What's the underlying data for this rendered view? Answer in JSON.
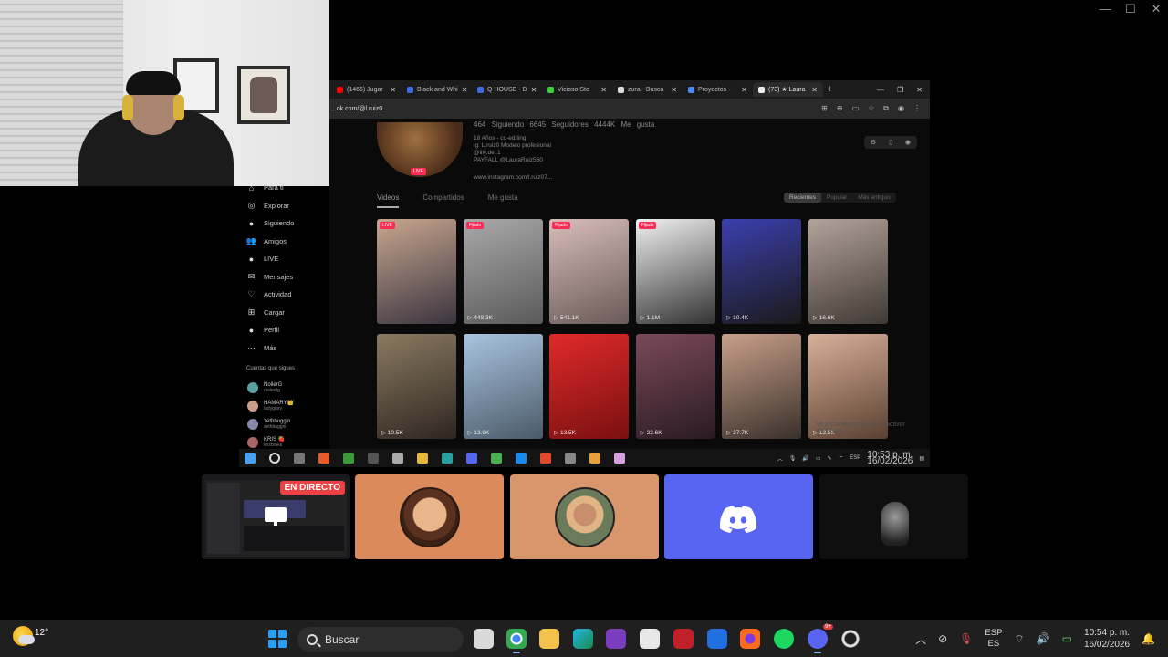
{
  "webcam": {},
  "browser": {
    "tabs": [
      {
        "label": "(1466) Jugar",
        "color": "#ff0000"
      },
      {
        "label": "Black and Whi",
        "color": "#3b6ce0"
      },
      {
        "label": "Q HOUSE - D",
        "color": "#3b6ce0"
      },
      {
        "label": "Vicioso Sto",
        "color": "#3ad13a"
      },
      {
        "label": "zura - Busca",
        "color": "#dddddd"
      },
      {
        "label": "Proyectos -",
        "color": "#4a8cf0"
      },
      {
        "label": "(73) ★ Laura",
        "color": "#eeeeee"
      }
    ],
    "url": "...ok.com/@l.ruiz0",
    "profile": {
      "stats": "464  Siguiendo  6645  Seguidores  4444K  Me gusta",
      "bio_lines": [
        "18 Años - co-ed/ling",
        "lg: L.ruiz0 Modelo profesional",
        "@lily.del.1",
        "PAYFALL @LauraRuiz560",
        "www.instagram.com/l.ruiz07..."
      ],
      "live_badge": "LIVE"
    },
    "tabs_profile": [
      "Videos",
      "Compartidos",
      "Me gusta"
    ],
    "sort": [
      "Recientes",
      "Popular",
      "Más antiguo"
    ],
    "videos": [
      {
        "views": "",
        "badge": "LIVE",
        "c1": "#c8a68e",
        "c2": "#3b3540"
      },
      {
        "views": "▷ 448.3K",
        "badge": "Fijado",
        "c1": "#a9a9a9",
        "c2": "#5a5a5a"
      },
      {
        "views": "▷ 541.1K",
        "badge": "Fijado",
        "c1": "#d8bdb8",
        "c2": "#6a5a58"
      },
      {
        "views": "▷ 1.1M",
        "badge": "Fijado",
        "c1": "#f0f0f0",
        "c2": "#333333"
      },
      {
        "views": "▷ 10.4K",
        "badge": "",
        "c1": "#3b3fae",
        "c2": "#1a1a1a"
      },
      {
        "views": "▷ 16.6K",
        "badge": "",
        "c1": "#b3a39a",
        "c2": "#403934"
      },
      {
        "views": "▷ 10.5K",
        "badge": "",
        "c1": "#8a7a60",
        "c2": "#2e2620"
      },
      {
        "views": "▷ 13.9K",
        "badge": "",
        "c1": "#a9c4df",
        "c2": "#4b5a6a"
      },
      {
        "views": "▷ 13.5K",
        "badge": "",
        "c1": "#e02a2a",
        "c2": "#7a1010"
      },
      {
        "views": "▷ 22.6K",
        "badge": "",
        "c1": "#7a4a5a",
        "c2": "#2a1a22"
      },
      {
        "views": "▷ 27.7K",
        "badge": "",
        "c1": "#c8a08a",
        "c2": "#3a302a"
      },
      {
        "views": "▷ 13.5K",
        "badge": "",
        "c1": "#d8b09a",
        "c2": "#5a4030"
      }
    ],
    "watermark": "Ve a Configuración para activar Windows."
  },
  "sidebar": {
    "items": [
      {
        "label": "Para ti",
        "icon": "⌂"
      },
      {
        "label": "Explorar",
        "icon": "◎"
      },
      {
        "label": "Siguiendo",
        "icon": "●"
      },
      {
        "label": "Amigos",
        "icon": "👥"
      },
      {
        "label": "LIVE",
        "icon": "●"
      },
      {
        "label": "Mensajes",
        "icon": "✉"
      },
      {
        "label": "Actividad",
        "icon": "♡"
      },
      {
        "label": "Cargar",
        "icon": "⊞"
      },
      {
        "label": "Perfil",
        "icon": "●"
      },
      {
        "label": "Más",
        "icon": "···"
      }
    ],
    "following_heading": "Cuentas que sigues",
    "accounts": [
      {
        "name": "NoilerG",
        "sub": "noilerdg",
        "color": "#5aa0a0"
      },
      {
        "name": "HAMARY👑",
        "sub": "ladygiary",
        "color": "#c8a08a"
      },
      {
        "name": "zethbuggin",
        "sub": "zethbuggin",
        "color": "#8888aa"
      },
      {
        "name": "KRIS 🍓",
        "sub": "kriscelikk",
        "color": "#aa6666"
      }
    ]
  },
  "inner_taskbar": {
    "lang": "ESP",
    "time": "10:53 p. m.",
    "date": "16/02/2026"
  },
  "tiles": {
    "stream_label": "EN DIRECTO"
  },
  "taskbar": {
    "temperature": "12°",
    "search_placeholder": "Buscar",
    "lang_top": "ESP",
    "lang_bottom": "ES",
    "time": "10:54 p. m.",
    "date": "16/02/2026",
    "discord_badge": "9+"
  }
}
